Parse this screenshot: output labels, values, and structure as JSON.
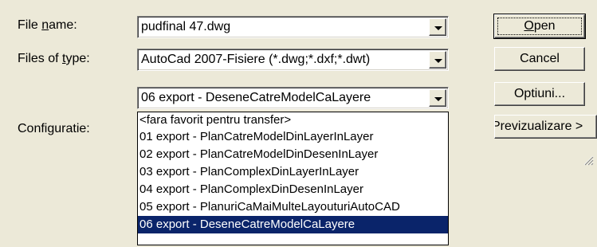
{
  "labels": {
    "file_name_pre": "File ",
    "file_name_key": "n",
    "file_name_post": "ame:",
    "files_of_type_pre": "Files of ",
    "files_of_type_key": "t",
    "files_of_type_post": "ype:",
    "configuratie": "Configuratie:"
  },
  "fields": {
    "file_name": "pudfinal 47.dwg",
    "file_type": "AutoCad 2007-Fisiere (*.dwg;*.dxf;*.dwt)",
    "configuratie_selected": "06 export - DeseneCatreModelCaLayere"
  },
  "buttons": {
    "open_key": "O",
    "open_rest": "pen",
    "cancel": "Cancel",
    "optiuni": "Optiuni...",
    "previzualizare": "Previzualizare >"
  },
  "dropdown_items": [
    "<fara favorit pentru transfer>",
    "01 export - PlanCatreModelDinLayerInLayer",
    "02 export - PlanCatreModelDinDesenInLayer",
    "03 export - PlanComplexDinLayerInLayer",
    "04 export - PlanComplexDinDesenInLayer",
    "05 export - PlanuriCaMaiMulteLayouturiAutoCAD",
    "06 export - DeseneCatreModelCaLayere"
  ],
  "selected_index": 6,
  "icons": {
    "dropdown_arrow": "chevron-down-icon",
    "resize_grip": "resize-grip-icon"
  }
}
